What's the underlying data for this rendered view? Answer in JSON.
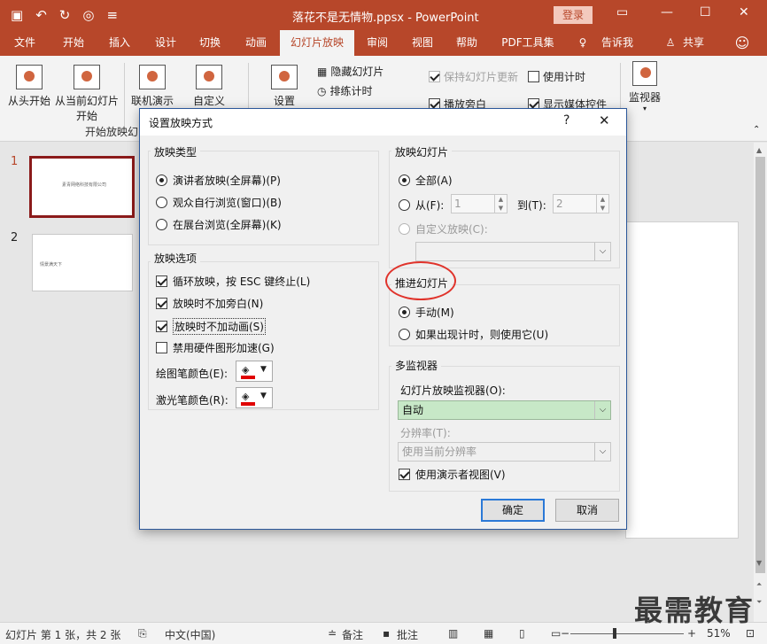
{
  "window": {
    "title": "落花不是无情物.ppsx  -  PowerPoint",
    "login": "登录",
    "qat_icons": [
      "save-icon",
      "undo-icon",
      "redo-icon",
      "present-icon",
      "customize-icon"
    ]
  },
  "tabs": [
    "文件",
    "开始",
    "插入",
    "设计",
    "切换",
    "动画",
    "幻灯片放映",
    "审阅",
    "视图",
    "帮助",
    "PDF工具集",
    "告诉我",
    "共享"
  ],
  "ribbon": {
    "from_start": "从头开始",
    "from_current_1": "从当前幻灯片",
    "from_current_2": "开始",
    "online": "联机演示",
    "custom": "自定义",
    "group_label": "开始放映幻",
    "setup": "设置",
    "hide_slide": "隐藏幻灯片",
    "rehearse": "排练计时",
    "keep_updated": "保持幻灯片更新",
    "use_timings": "使用计时",
    "play_narration": "播放旁白",
    "show_media": "显示媒体控件",
    "monitor": "监视器"
  },
  "thumbnails": [
    {
      "num": "1",
      "text": "素青网络科技有限公司"
    },
    {
      "num": "2",
      "text": "情景满天下"
    }
  ],
  "dialog": {
    "title": "设置放映方式",
    "help": "?",
    "show_type": {
      "title": "放映类型",
      "options": [
        "演讲者放映(全屏幕)(P)",
        "观众自行浏览(窗口)(B)",
        "在展台浏览(全屏幕)(K)"
      ]
    },
    "show_options": {
      "title": "放映选项",
      "loop": "循环放映，按 ESC 键终止(L)",
      "no_narration": "放映时不加旁白(N)",
      "no_animation": "放映时不加动画(S)",
      "no_hw": "禁用硬件图形加速(G)",
      "pen_color": "绘图笔颜色(E):",
      "laser_color": "激光笔颜色(R):"
    },
    "show_slides": {
      "title": "放映幻灯片",
      "all": "全部(A)",
      "from": "从(F):",
      "from_value": "1",
      "to": "到(T):",
      "to_value": "2",
      "custom": "自定义放映(C):"
    },
    "advance": {
      "title": "推进幻灯片",
      "manual": "手动(M)",
      "timings": "如果出现计时，则使用它(U)"
    },
    "multi_monitor": {
      "title": "多监视器",
      "monitor_label": "幻灯片放映监视器(O):",
      "monitor_value": "自动",
      "resolution_label": "分辨率(T):",
      "resolution_value": "使用当前分辨率",
      "presenter_view": "使用演示者视图(V)"
    },
    "ok": "确定",
    "cancel": "取消"
  },
  "status": {
    "slide_info": "幻灯片 第 1 张，共 2 张",
    "language": "中文(中国)",
    "notes": "备注",
    "comments": "批注",
    "zoom": "51%"
  },
  "watermark": "最需教育",
  "colors": {
    "accent": "#b7472a",
    "pen": "#e00000",
    "highlight_ellipse": "#e0332b"
  }
}
